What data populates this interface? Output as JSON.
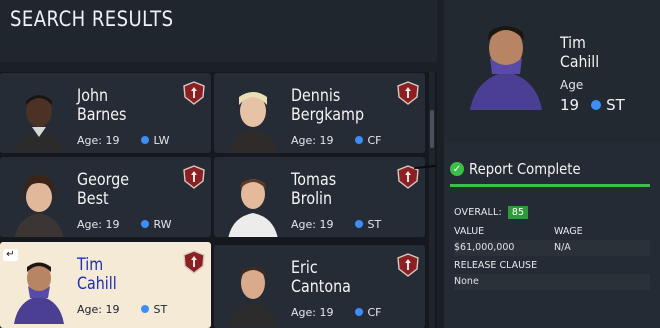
{
  "header": {
    "title": "SEARCH RESULTS"
  },
  "players": [
    {
      "name_line1": "John",
      "name_line2": "Barnes",
      "age": "Age: 19",
      "position": "LW",
      "selected": false
    },
    {
      "name_line1": "Dennis",
      "name_line2": "Bergkamp",
      "age": "Age: 19",
      "position": "CF",
      "selected": false
    },
    {
      "name_line1": "George",
      "name_line2": "Best",
      "age": "Age: 19",
      "position": "RW",
      "selected": false
    },
    {
      "name_line1": "Tomas",
      "name_line2": "Brolin",
      "age": "Age: 19",
      "position": "ST",
      "selected": false
    },
    {
      "name_line1": "Tim",
      "name_line2": "Cahill",
      "age": "Age: 19",
      "position": "ST",
      "selected": true
    },
    {
      "name_line1": "Eric",
      "name_line2": "Cantona",
      "age": "Age: 19",
      "position": "CF",
      "selected": false
    }
  ],
  "detail": {
    "name_line1": "Tim",
    "name_line2": "Cahill",
    "age_label": "Age",
    "age_value": "19",
    "position": "ST",
    "report_title": "Report Complete",
    "overall_label": "OVERALL:",
    "overall_value": "85",
    "value_label": "VALUE",
    "value": "$61,000,000",
    "wage_label": "WAGE",
    "wage": "N/A",
    "release_label": "RELEASE CLAUSE",
    "release": "None"
  },
  "back_icon": "↵",
  "colors": {
    "accent_green": "#3bbf49",
    "position_blue": "#3e8ef7",
    "selected_card": "#f4ead6"
  }
}
